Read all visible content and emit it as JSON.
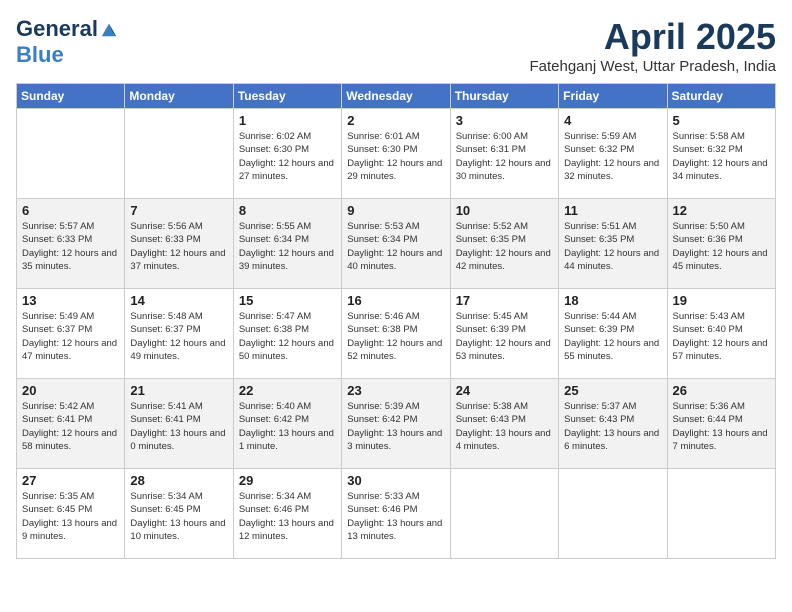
{
  "logo": {
    "general": "General",
    "blue": "Blue"
  },
  "title": {
    "month": "April 2025",
    "location": "Fatehganj West, Uttar Pradesh, India"
  },
  "days_of_week": [
    "Sunday",
    "Monday",
    "Tuesday",
    "Wednesday",
    "Thursday",
    "Friday",
    "Saturday"
  ],
  "weeks": [
    [
      {
        "day": "",
        "info": ""
      },
      {
        "day": "",
        "info": ""
      },
      {
        "day": "1",
        "info": "Sunrise: 6:02 AM\nSunset: 6:30 PM\nDaylight: 12 hours and 27 minutes."
      },
      {
        "day": "2",
        "info": "Sunrise: 6:01 AM\nSunset: 6:30 PM\nDaylight: 12 hours and 29 minutes."
      },
      {
        "day": "3",
        "info": "Sunrise: 6:00 AM\nSunset: 6:31 PM\nDaylight: 12 hours and 30 minutes."
      },
      {
        "day": "4",
        "info": "Sunrise: 5:59 AM\nSunset: 6:32 PM\nDaylight: 12 hours and 32 minutes."
      },
      {
        "day": "5",
        "info": "Sunrise: 5:58 AM\nSunset: 6:32 PM\nDaylight: 12 hours and 34 minutes."
      }
    ],
    [
      {
        "day": "6",
        "info": "Sunrise: 5:57 AM\nSunset: 6:33 PM\nDaylight: 12 hours and 35 minutes."
      },
      {
        "day": "7",
        "info": "Sunrise: 5:56 AM\nSunset: 6:33 PM\nDaylight: 12 hours and 37 minutes."
      },
      {
        "day": "8",
        "info": "Sunrise: 5:55 AM\nSunset: 6:34 PM\nDaylight: 12 hours and 39 minutes."
      },
      {
        "day": "9",
        "info": "Sunrise: 5:53 AM\nSunset: 6:34 PM\nDaylight: 12 hours and 40 minutes."
      },
      {
        "day": "10",
        "info": "Sunrise: 5:52 AM\nSunset: 6:35 PM\nDaylight: 12 hours and 42 minutes."
      },
      {
        "day": "11",
        "info": "Sunrise: 5:51 AM\nSunset: 6:35 PM\nDaylight: 12 hours and 44 minutes."
      },
      {
        "day": "12",
        "info": "Sunrise: 5:50 AM\nSunset: 6:36 PM\nDaylight: 12 hours and 45 minutes."
      }
    ],
    [
      {
        "day": "13",
        "info": "Sunrise: 5:49 AM\nSunset: 6:37 PM\nDaylight: 12 hours and 47 minutes."
      },
      {
        "day": "14",
        "info": "Sunrise: 5:48 AM\nSunset: 6:37 PM\nDaylight: 12 hours and 49 minutes."
      },
      {
        "day": "15",
        "info": "Sunrise: 5:47 AM\nSunset: 6:38 PM\nDaylight: 12 hours and 50 minutes."
      },
      {
        "day": "16",
        "info": "Sunrise: 5:46 AM\nSunset: 6:38 PM\nDaylight: 12 hours and 52 minutes."
      },
      {
        "day": "17",
        "info": "Sunrise: 5:45 AM\nSunset: 6:39 PM\nDaylight: 12 hours and 53 minutes."
      },
      {
        "day": "18",
        "info": "Sunrise: 5:44 AM\nSunset: 6:39 PM\nDaylight: 12 hours and 55 minutes."
      },
      {
        "day": "19",
        "info": "Sunrise: 5:43 AM\nSunset: 6:40 PM\nDaylight: 12 hours and 57 minutes."
      }
    ],
    [
      {
        "day": "20",
        "info": "Sunrise: 5:42 AM\nSunset: 6:41 PM\nDaylight: 12 hours and 58 minutes."
      },
      {
        "day": "21",
        "info": "Sunrise: 5:41 AM\nSunset: 6:41 PM\nDaylight: 13 hours and 0 minutes."
      },
      {
        "day": "22",
        "info": "Sunrise: 5:40 AM\nSunset: 6:42 PM\nDaylight: 13 hours and 1 minute."
      },
      {
        "day": "23",
        "info": "Sunrise: 5:39 AM\nSunset: 6:42 PM\nDaylight: 13 hours and 3 minutes."
      },
      {
        "day": "24",
        "info": "Sunrise: 5:38 AM\nSunset: 6:43 PM\nDaylight: 13 hours and 4 minutes."
      },
      {
        "day": "25",
        "info": "Sunrise: 5:37 AM\nSunset: 6:43 PM\nDaylight: 13 hours and 6 minutes."
      },
      {
        "day": "26",
        "info": "Sunrise: 5:36 AM\nSunset: 6:44 PM\nDaylight: 13 hours and 7 minutes."
      }
    ],
    [
      {
        "day": "27",
        "info": "Sunrise: 5:35 AM\nSunset: 6:45 PM\nDaylight: 13 hours and 9 minutes."
      },
      {
        "day": "28",
        "info": "Sunrise: 5:34 AM\nSunset: 6:45 PM\nDaylight: 13 hours and 10 minutes."
      },
      {
        "day": "29",
        "info": "Sunrise: 5:34 AM\nSunset: 6:46 PM\nDaylight: 13 hours and 12 minutes."
      },
      {
        "day": "30",
        "info": "Sunrise: 5:33 AM\nSunset: 6:46 PM\nDaylight: 13 hours and 13 minutes."
      },
      {
        "day": "",
        "info": ""
      },
      {
        "day": "",
        "info": ""
      },
      {
        "day": "",
        "info": ""
      }
    ]
  ]
}
